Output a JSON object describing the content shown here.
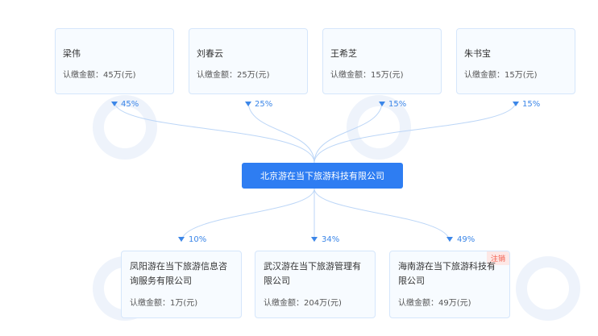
{
  "shareholders": [
    {
      "name": "梁伟",
      "amount": "认缴金额：45万(元)",
      "percent": "45%"
    },
    {
      "name": "刘春云",
      "amount": "认缴金额：25万(元)",
      "percent": "25%"
    },
    {
      "name": "王希芝",
      "amount": "认缴金额：15万(元)",
      "percent": "15%"
    },
    {
      "name": "朱书宝",
      "amount": "认缴金额：15万(元)",
      "percent": "15%"
    }
  ],
  "company": {
    "name": "北京游在当下旅游科技有限公司"
  },
  "subsidiaries": [
    {
      "name": "凤阳游在当下旅游信息咨询服务有限公司",
      "amount": "认缴金额：1万(元)",
      "percent": "10%",
      "badge": ""
    },
    {
      "name": "武汉游在当下旅游管理有限公司",
      "amount": "认缴金额：204万(元)",
      "percent": "34%",
      "badge": ""
    },
    {
      "name": "海南游在当下旅游科技有限公司",
      "amount": "认缴金额：49万(元)",
      "percent": "49%",
      "badge": "注销"
    }
  ],
  "colors": {
    "accent": "#2e7df2",
    "card_border": "#d5e6fb",
    "card_bg": "#f7fbff",
    "line": "#bcd6f7",
    "badge_text": "#f25a4a"
  },
  "icons": {
    "arrow": "down-arrow-icon"
  }
}
